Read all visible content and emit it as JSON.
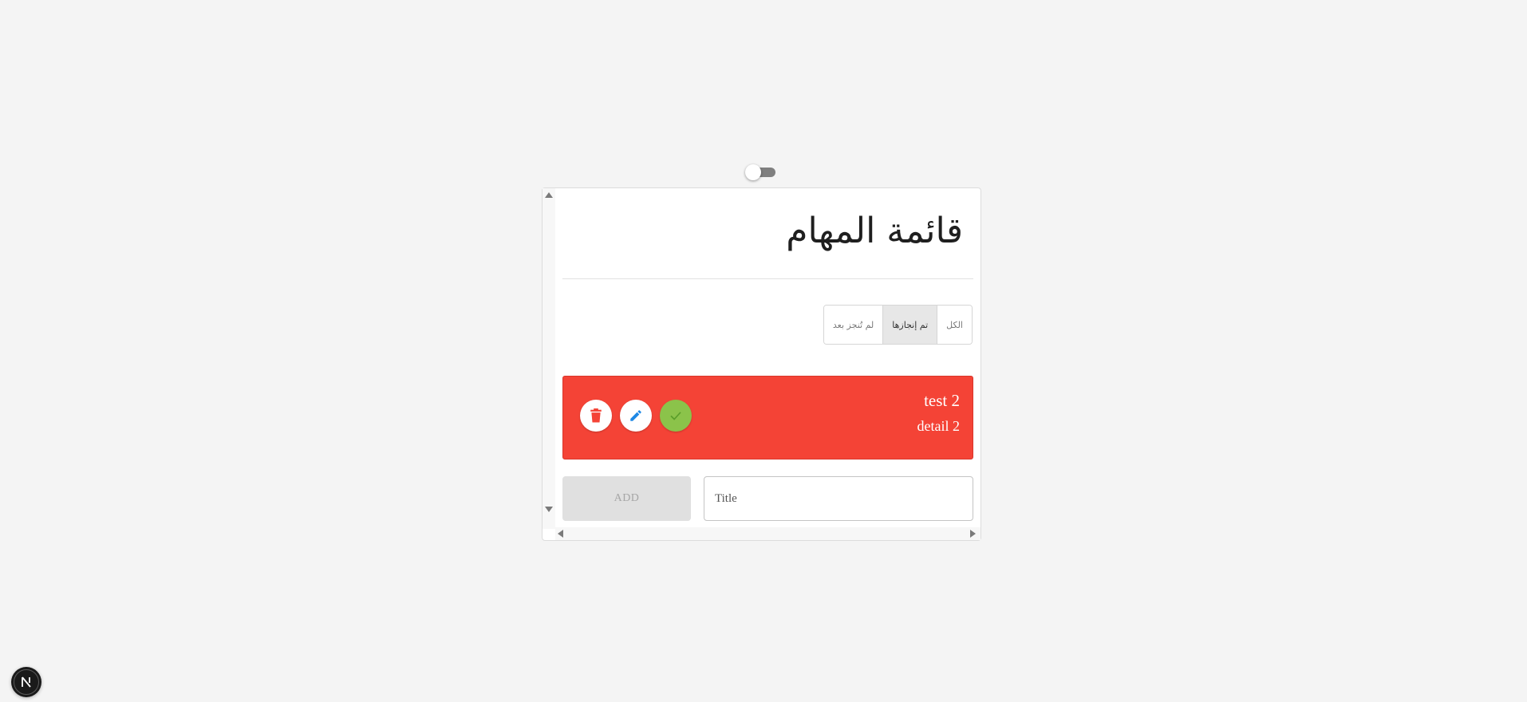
{
  "app": {
    "title": "قائمة المهام"
  },
  "filters": [
    {
      "label": "الكل",
      "active": false
    },
    {
      "label": "تم إنجازها",
      "active": true
    },
    {
      "label": "لم تُنجز بعد",
      "active": false
    }
  ],
  "task": {
    "title": "test 2",
    "detail": "detail 2",
    "background_color": "#f44336",
    "actions": [
      {
        "name": "delete",
        "icon": "trash-icon",
        "color": "#f44336"
      },
      {
        "name": "edit",
        "icon": "pencil-icon",
        "color": "#1e88e5"
      },
      {
        "name": "complete",
        "icon": "check-icon",
        "color": "#8bc34a"
      }
    ]
  },
  "form": {
    "add_label": "ADD",
    "title_placeholder": "Title",
    "title_value": ""
  },
  "theme_toggle": {
    "dark_mode": false
  },
  "dev_indicator": {
    "label": "N"
  }
}
